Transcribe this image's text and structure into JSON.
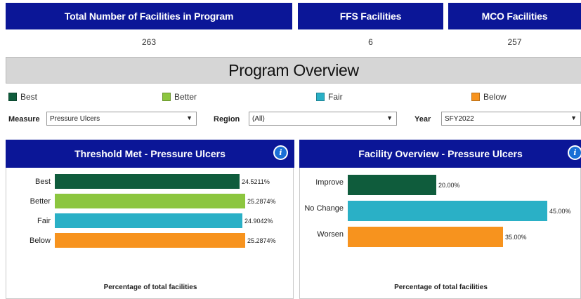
{
  "kpis": [
    {
      "label": "Total Number of Facilities in Program",
      "value": "263"
    },
    {
      "label": "FFS Facilities",
      "value": "6"
    },
    {
      "label": "MCO Facilities",
      "value": "257"
    }
  ],
  "banner": "Program Overview",
  "legend": [
    {
      "label": "Best",
      "color": "#0f5c3c"
    },
    {
      "label": "Better",
      "color": "#8cc63f"
    },
    {
      "label": "Fair",
      "color": "#2ab0c6"
    },
    {
      "label": "Below",
      "color": "#f7931e"
    }
  ],
  "filters": {
    "measure": {
      "label": "Measure",
      "value": "Pressure Ulcers"
    },
    "region": {
      "label": "Region",
      "value": "(All)"
    },
    "year": {
      "label": "Year",
      "value": "SFY2022"
    }
  },
  "panels": {
    "threshold": {
      "title": "Threshold Met - Pressure Ulcers",
      "axis_title": "Percentage of total facilities",
      "info_glyph": "i"
    },
    "facility": {
      "title": "Facility Overview - Pressure Ulcers",
      "axis_title": "Percentage of total facilities",
      "info_glyph": "i"
    }
  },
  "chart_data": [
    {
      "type": "bar",
      "orientation": "horizontal",
      "title": "Threshold Met - Pressure Ulcers",
      "xlabel": "Percentage of total facilities",
      "categories": [
        "Best",
        "Better",
        "Fair",
        "Below"
      ],
      "values": [
        24.5211,
        25.2874,
        24.9042,
        25.2874
      ],
      "value_labels": [
        "24.5211%",
        "25.2874%",
        "24.9042%",
        "25.2874%"
      ],
      "colors": [
        "#0f5c3c",
        "#8cc63f",
        "#2ab0c6",
        "#f7931e"
      ],
      "xlim": [
        0,
        25.2874
      ]
    },
    {
      "type": "bar",
      "orientation": "horizontal",
      "title": "Facility Overview - Pressure Ulcers",
      "xlabel": "Percentage of total facilities",
      "categories": [
        "Improve",
        "No Change",
        "Worsen"
      ],
      "values": [
        20,
        45,
        35
      ],
      "value_labels": [
        "20.00%",
        "45.00%",
        "35.00%"
      ],
      "colors": [
        "#0f5c3c",
        "#2ab0c6",
        "#f7931e"
      ],
      "xlim": [
        0,
        45
      ]
    }
  ]
}
